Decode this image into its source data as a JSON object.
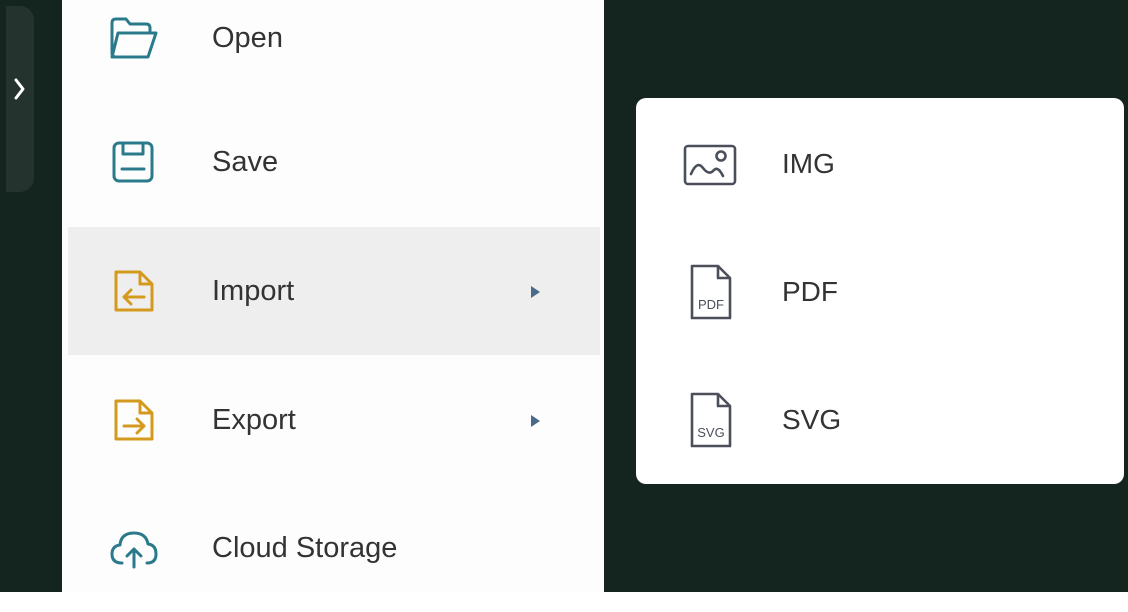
{
  "file_menu": {
    "items": [
      {
        "label": "Open",
        "icon": "folder-open-icon",
        "color": "#2b7a8c"
      },
      {
        "label": "Save",
        "icon": "save-icon",
        "color": "#2b7a8c"
      },
      {
        "label": "Import",
        "icon": "file-import-icon",
        "color": "#d49a1e",
        "has_submenu": true,
        "active": true
      },
      {
        "label": "Export",
        "icon": "file-export-icon",
        "color": "#d49a1e",
        "has_submenu": true
      },
      {
        "label": "Cloud Storage",
        "icon": "cloud-upload-icon",
        "color": "#2b7a8c"
      }
    ]
  },
  "import_submenu": {
    "items": [
      {
        "label": "IMG",
        "icon": "image-icon"
      },
      {
        "label": "PDF",
        "icon": "pdf-file-icon",
        "icon_text": "PDF"
      },
      {
        "label": "SVG",
        "icon": "svg-file-icon",
        "icon_text": "SVG"
      }
    ]
  },
  "colors": {
    "background_dark": "#14241f",
    "active_row": "#eeeeee",
    "teal_icon": "#2b7a8c",
    "gold_icon": "#d49a1e",
    "submenu_icon": "#4a4f5a"
  }
}
